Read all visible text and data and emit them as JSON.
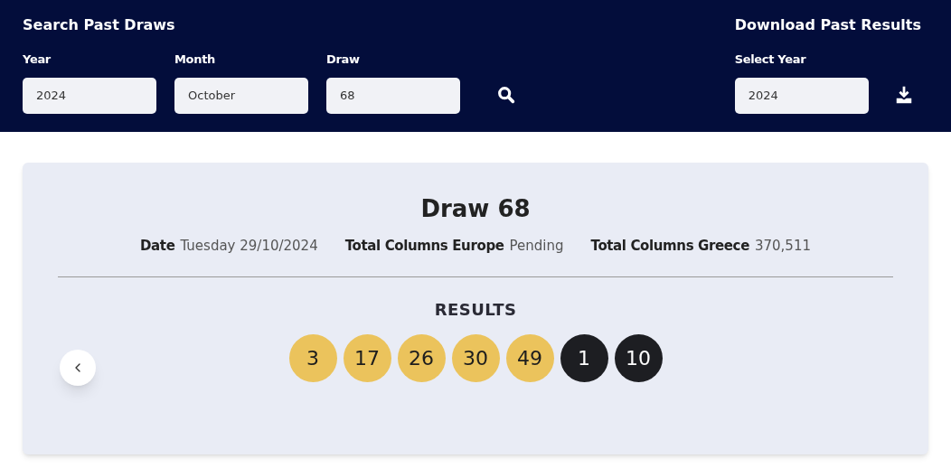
{
  "search": {
    "title": "Search Past Draws",
    "fields": [
      {
        "label": "Year",
        "value": "2024"
      },
      {
        "label": "Month",
        "value": "October"
      },
      {
        "label": "Draw",
        "value": "68"
      }
    ]
  },
  "download": {
    "title": "Download Past Results",
    "label": "Select Year",
    "value": "2024"
  },
  "draw": {
    "title": "Draw 68",
    "details": [
      {
        "label": "Date",
        "value": "Tuesday 29/10/2024"
      },
      {
        "label": "Total Columns Europe",
        "value": "Pending"
      },
      {
        "label": "Total Columns Greece",
        "value": "370,511"
      }
    ],
    "results_title": "RESULTS",
    "numbers": [
      {
        "value": "3",
        "kind": "main"
      },
      {
        "value": "17",
        "kind": "main"
      },
      {
        "value": "26",
        "kind": "main"
      },
      {
        "value": "30",
        "kind": "main"
      },
      {
        "value": "49",
        "kind": "main"
      },
      {
        "value": "1",
        "kind": "bonus"
      },
      {
        "value": "10",
        "kind": "bonus"
      }
    ]
  }
}
